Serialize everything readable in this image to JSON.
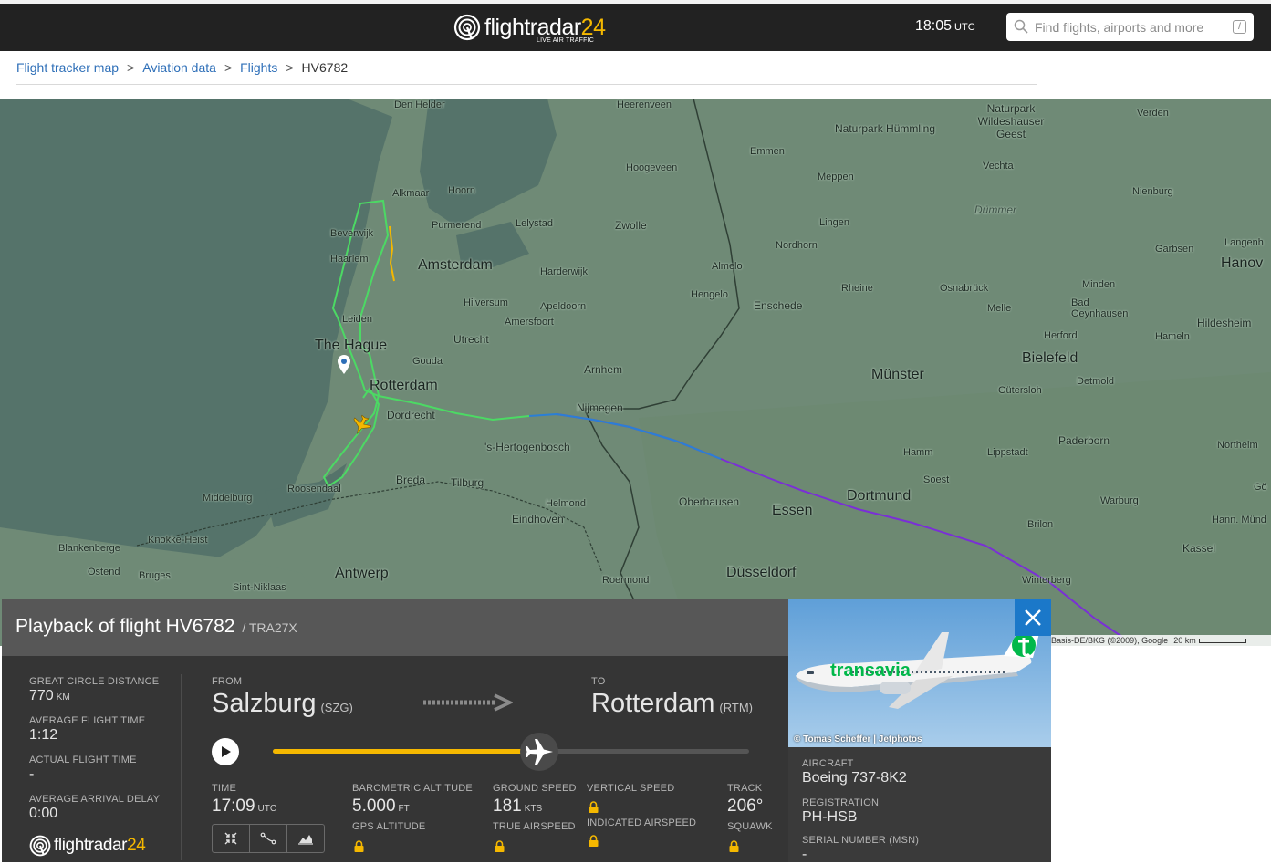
{
  "header": {
    "logo_text": "flightradar",
    "logo_num": "24",
    "logo_tagline": "LIVE AIR TRAFFIC",
    "time": "18:05",
    "time_zone": "UTC",
    "search_placeholder": "Find flights, airports and more",
    "search_shortcut": "/"
  },
  "breadcrumb": {
    "items": [
      "Flight tracker map",
      "Aviation data",
      "Flights"
    ],
    "current": "HV6782",
    "separator": ">"
  },
  "map": {
    "places": [
      "Den Helder",
      "Heerenveen",
      "Naturpark Hümmling",
      "Naturpark Wildeshauser Geest",
      "Verden",
      "Emmen",
      "Hoogeveen",
      "Meppen",
      "Vechta",
      "Alkmaar",
      "Hoorn",
      "Purmerend",
      "Lelystad",
      "Zwolle",
      "Lingen",
      "Nienburg",
      "Dümmer",
      "Beverwijk",
      "Haarlem",
      "Amsterdam",
      "Harderwijk",
      "Nordhorn",
      "Almelo",
      "Garbsen",
      "Langenh",
      "Hanov",
      "Leiden",
      "Hilversum",
      "Apeldoorn",
      "Hengelo",
      "Enschede",
      "Rheine",
      "Osnabrück",
      "Minden",
      "Melle",
      "Bad Oeynhausen",
      "Hildesheim",
      "The Hague",
      "Utrecht",
      "Amersfoort",
      "Herford",
      "Hameln",
      "Gouda",
      "Arnhem",
      "Bielefeld",
      "Rotterdam",
      "Münster",
      "Detmold",
      "Gütersloh",
      "Nijmegen",
      "Dordrecht",
      "'s-Hertogenbosch",
      "Hamm",
      "Lippstadt",
      "Paderborn",
      "Northeim",
      "Breda",
      "Tilburg",
      "Roosendaal",
      "Soest",
      "Dortmund",
      "Middelburg",
      "Helmond",
      "Oberhausen",
      "Essen",
      "Warburg",
      "Eindhoven",
      "Brilon",
      "Hann. Münd",
      "Knokke-Heist",
      "Blankenberge",
      "Ostend",
      "Bruges",
      "Antwerp",
      "Kassel",
      "Sint-Niklaas",
      "Roermond",
      "Düsseldorf",
      "Winterberg",
      "Gö"
    ],
    "attribution": "Basis-DE/BKG (©2009), Google",
    "scale_label": "20 km"
  },
  "playback": {
    "title": "Playback of flight HV6782",
    "callsign": "/ TRA27X",
    "great_circle_distance_label": "GREAT CIRCLE DISTANCE",
    "great_circle_distance": "770",
    "great_circle_distance_unit": "KM",
    "avg_flight_time_label": "AVERAGE FLIGHT TIME",
    "avg_flight_time": "1:12",
    "actual_flight_time_label": "ACTUAL FLIGHT TIME",
    "actual_flight_time": "-",
    "avg_arrival_delay_label": "AVERAGE ARRIVAL DELAY",
    "avg_arrival_delay": "0:00",
    "from_label": "FROM",
    "from_city": "Salzburg",
    "from_code": "(SZG)",
    "to_label": "TO",
    "to_city": "Rotterdam",
    "to_code": "(RTM)",
    "progress": 0.56,
    "time_label": "TIME",
    "time": "17:09",
    "time_unit": "UTC",
    "baro_alt_label": "BAROMETRIC ALTITUDE",
    "baro_alt": "5.000",
    "baro_alt_unit": "FT",
    "gps_alt_label": "GPS ALTITUDE",
    "ground_speed_label": "GROUND SPEED",
    "ground_speed": "181",
    "ground_speed_unit": "KTS",
    "true_airspeed_label": "TRUE AIRSPEED",
    "vertical_speed_label": "VERTICAL SPEED",
    "indicated_airspeed_label": "INDICATED AIRSPEED",
    "track_label": "TRACK",
    "track": "206°",
    "squawk_label": "SQUAWK"
  },
  "aircraft": {
    "photo_credit": "© Tomas Scheffer | Jetphotos",
    "aircraft_label": "AIRCRAFT",
    "aircraft": "Boeing 737-8K2",
    "registration_label": "REGISTRATION",
    "registration": "PH-HSB",
    "msn_label": "SERIAL NUMBER (MSN)",
    "msn": "-",
    "livery_text": "transavia"
  },
  "colors": {
    "header_bg": "#222222",
    "accent": "#f5b800",
    "link": "#2e6fb8",
    "close_button": "#1b78c9",
    "track_green": "#4cd964",
    "track_blue": "#2a7fd6",
    "track_purple": "#7a2fd6"
  }
}
